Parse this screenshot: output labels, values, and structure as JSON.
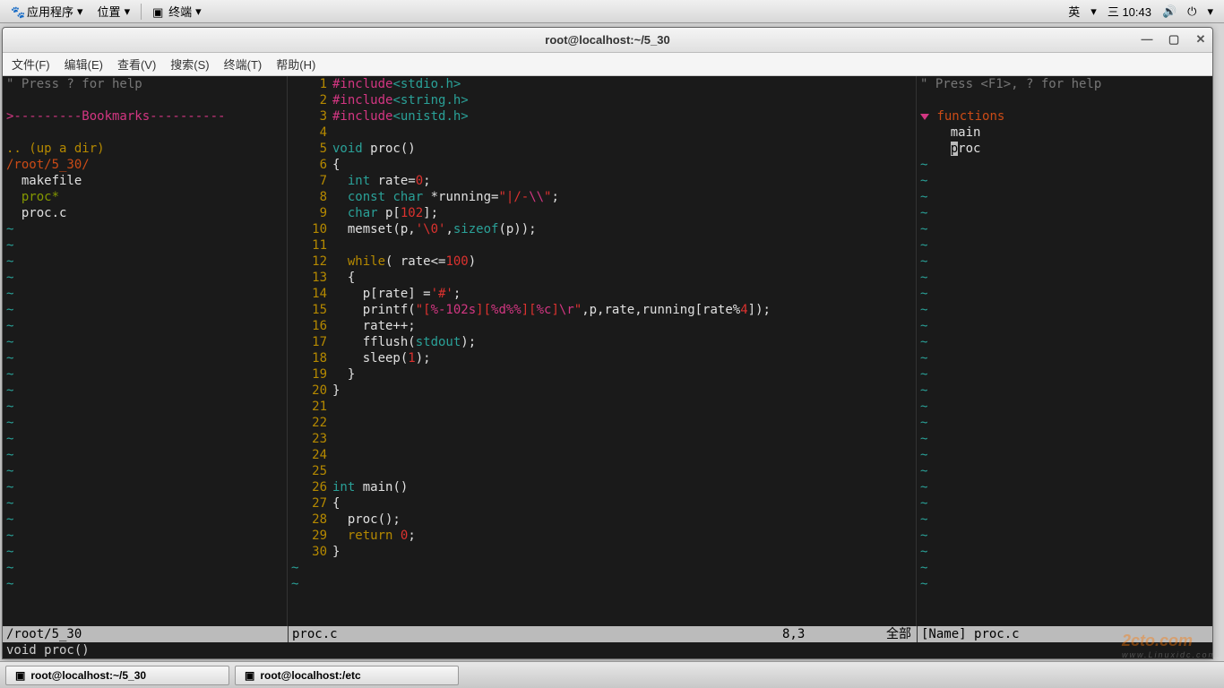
{
  "panel": {
    "apps": "应用程序",
    "places": "位置",
    "terminal": "终端",
    "lang": "英",
    "clock": "三 10:43"
  },
  "window": {
    "title": "root@localhost:~/5_30"
  },
  "menubar": {
    "file": "文件(F)",
    "edit": "编辑(E)",
    "view": "查看(V)",
    "search": "搜索(S)",
    "terminal": "终端(T)",
    "help": "帮助(H)"
  },
  "left": {
    "help": "\" Press ? for help",
    "bookmarks": ">---------Bookmarks----------",
    "up": ".. (up a dir)",
    "path": "/root/5_30/",
    "f1": "makefile",
    "f2": "proc*",
    "f3": "proc.c"
  },
  "code": {
    "lines": [
      {
        "n": 1,
        "seg": [
          {
            "c": "magenta",
            "t": "#include"
          },
          {
            "c": "cyan",
            "t": "<stdio.h>"
          }
        ]
      },
      {
        "n": 2,
        "seg": [
          {
            "c": "magenta",
            "t": "#include"
          },
          {
            "c": "cyan",
            "t": "<string.h>"
          }
        ]
      },
      {
        "n": 3,
        "seg": [
          {
            "c": "magenta",
            "t": "#include"
          },
          {
            "c": "cyan",
            "t": "<unistd.h>"
          }
        ]
      },
      {
        "n": 4,
        "seg": []
      },
      {
        "n": 5,
        "seg": [
          {
            "c": "cyan",
            "t": "void"
          },
          {
            "c": "white",
            "t": " proc()"
          }
        ]
      },
      {
        "n": 6,
        "seg": [
          {
            "c": "white",
            "t": "{"
          }
        ]
      },
      {
        "n": 7,
        "seg": [
          {
            "c": "white",
            "t": "  "
          },
          {
            "c": "cyan",
            "t": "int"
          },
          {
            "c": "white",
            "t": " rate="
          },
          {
            "c": "red",
            "t": "0"
          },
          {
            "c": "white",
            "t": ";"
          }
        ]
      },
      {
        "n": 8,
        "seg": [
          {
            "c": "white",
            "t": "  "
          },
          {
            "c": "cyan",
            "t": "const"
          },
          {
            "c": "white",
            "t": " "
          },
          {
            "c": "cyan",
            "t": "char"
          },
          {
            "c": "white",
            "t": " *running="
          },
          {
            "c": "red",
            "t": "\"|/-"
          },
          {
            "c": "magenta",
            "t": "\\\\"
          },
          {
            "c": "red",
            "t": "\""
          },
          {
            "c": "white",
            "t": ";"
          }
        ]
      },
      {
        "n": 9,
        "seg": [
          {
            "c": "white",
            "t": "  "
          },
          {
            "c": "cyan",
            "t": "char"
          },
          {
            "c": "white",
            "t": " p["
          },
          {
            "c": "red",
            "t": "102"
          },
          {
            "c": "white",
            "t": "];"
          }
        ]
      },
      {
        "n": 10,
        "seg": [
          {
            "c": "white",
            "t": "  memset(p,"
          },
          {
            "c": "red",
            "t": "'\\0'"
          },
          {
            "c": "white",
            "t": ","
          },
          {
            "c": "cyan",
            "t": "sizeof"
          },
          {
            "c": "white",
            "t": "(p));"
          }
        ]
      },
      {
        "n": 11,
        "seg": []
      },
      {
        "n": 12,
        "seg": [
          {
            "c": "white",
            "t": "  "
          },
          {
            "c": "yellow",
            "t": "while"
          },
          {
            "c": "white",
            "t": "( rate<="
          },
          {
            "c": "red",
            "t": "100"
          },
          {
            "c": "white",
            "t": ")"
          }
        ]
      },
      {
        "n": 13,
        "seg": [
          {
            "c": "white",
            "t": "  {"
          }
        ]
      },
      {
        "n": 14,
        "seg": [
          {
            "c": "white",
            "t": "    p[rate] ="
          },
          {
            "c": "red",
            "t": "'#'"
          },
          {
            "c": "white",
            "t": ";"
          }
        ]
      },
      {
        "n": 15,
        "seg": [
          {
            "c": "white",
            "t": "    printf("
          },
          {
            "c": "red",
            "t": "\"["
          },
          {
            "c": "magenta",
            "t": "%-102s"
          },
          {
            "c": "red",
            "t": "]["
          },
          {
            "c": "magenta",
            "t": "%d%%"
          },
          {
            "c": "red",
            "t": "]["
          },
          {
            "c": "magenta",
            "t": "%c"
          },
          {
            "c": "red",
            "t": "]"
          },
          {
            "c": "magenta",
            "t": "\\r"
          },
          {
            "c": "red",
            "t": "\""
          },
          {
            "c": "white",
            "t": ",p,rate,running[rate%"
          },
          {
            "c": "red",
            "t": "4"
          },
          {
            "c": "white",
            "t": "]);"
          }
        ]
      },
      {
        "n": 16,
        "seg": [
          {
            "c": "white",
            "t": "    rate++;"
          }
        ]
      },
      {
        "n": 17,
        "seg": [
          {
            "c": "white",
            "t": "    fflush("
          },
          {
            "c": "cyan",
            "t": "stdout"
          },
          {
            "c": "white",
            "t": ");"
          }
        ]
      },
      {
        "n": 18,
        "seg": [
          {
            "c": "white",
            "t": "    sleep("
          },
          {
            "c": "red",
            "t": "1"
          },
          {
            "c": "white",
            "t": ");"
          }
        ]
      },
      {
        "n": 19,
        "seg": [
          {
            "c": "white",
            "t": "  }"
          }
        ]
      },
      {
        "n": 20,
        "seg": [
          {
            "c": "white",
            "t": "}"
          }
        ]
      },
      {
        "n": 21,
        "seg": []
      },
      {
        "n": 22,
        "seg": []
      },
      {
        "n": 23,
        "seg": []
      },
      {
        "n": 24,
        "seg": []
      },
      {
        "n": 25,
        "seg": []
      },
      {
        "n": 26,
        "seg": [
          {
            "c": "cyan",
            "t": "int"
          },
          {
            "c": "white",
            "t": " main()"
          }
        ]
      },
      {
        "n": 27,
        "seg": [
          {
            "c": "white",
            "t": "{"
          }
        ]
      },
      {
        "n": 28,
        "seg": [
          {
            "c": "white",
            "t": "  proc();"
          }
        ]
      },
      {
        "n": 29,
        "seg": [
          {
            "c": "white",
            "t": "  "
          },
          {
            "c": "yellow",
            "t": "return"
          },
          {
            "c": "white",
            "t": " "
          },
          {
            "c": "red",
            "t": "0"
          },
          {
            "c": "white",
            "t": ";"
          }
        ]
      },
      {
        "n": 30,
        "seg": [
          {
            "c": "white",
            "t": "}"
          }
        ]
      }
    ]
  },
  "right": {
    "help": "\" Press <F1>, ? for help",
    "functions": "functions",
    "main": "main",
    "proc": "proc",
    "proc_first": "p",
    "proc_rest": "roc",
    "name_label": "[Name]",
    "name_file": "proc.c"
  },
  "status": {
    "left_path": "/root/5_30",
    "mid_file": "proc.c",
    "pos": "8,3",
    "all": "全部"
  },
  "cmdline": "void proc()",
  "taskbar": {
    "t1": "root@localhost:~/5_30",
    "t2": "root@localhost:/etc"
  }
}
